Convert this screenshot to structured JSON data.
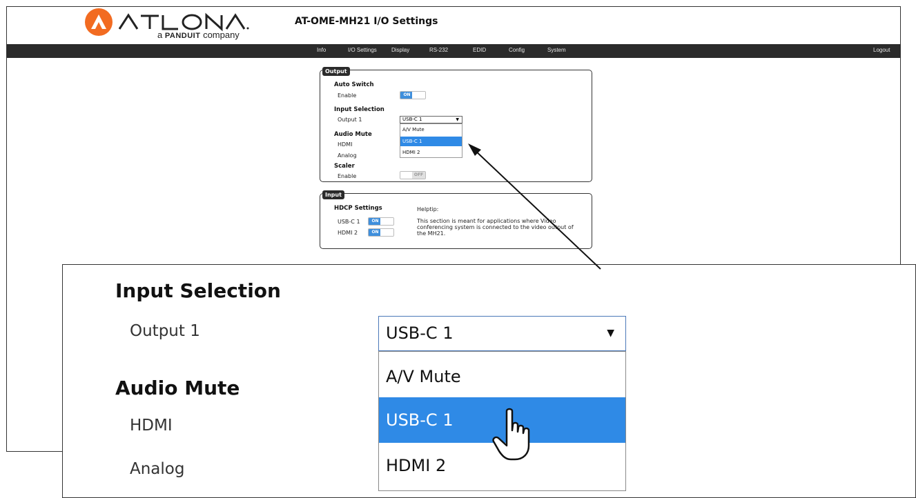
{
  "brand": {
    "logo_text": "ATLONA",
    "tagline_prefix": "a",
    "tagline_brand": "PANDUIT",
    "tagline_suffix": "company",
    "accent_color": "#f26b21"
  },
  "page_title": "AT-OME-MH21  I/O Settings",
  "nav": {
    "items": [
      "Info",
      "I/O Settings",
      "Display",
      "RS-232",
      "EDID",
      "Config",
      "System"
    ],
    "logout": "Logout"
  },
  "output_panel": {
    "legend": "Output",
    "auto_switch": {
      "heading": "Auto Switch",
      "label": "Enable",
      "state": "ON"
    },
    "input_selection": {
      "heading": "Input Selection",
      "label": "Output 1",
      "selected": "USB-C 1",
      "options": [
        "A/V Mute",
        "USB-C 1",
        "HDMI 2"
      ],
      "highlighted_index": 1
    },
    "audio_mute": {
      "heading": "Audio Mute",
      "hdmi_label": "HDMI",
      "analog_label": "Analog"
    },
    "scaler": {
      "heading": "Scaler",
      "label": "Enable",
      "state": "OFF"
    }
  },
  "input_panel": {
    "legend": "Input",
    "hdcp": {
      "heading": "HDCP Settings",
      "rows": [
        {
          "label": "USB-C 1",
          "state": "ON"
        },
        {
          "label": "HDMI 2",
          "state": "ON"
        }
      ]
    },
    "helptip": {
      "title": "Helptip:",
      "line1": "This section is meant for applications where Video",
      "line2": "conferencing system is connected to the video output of",
      "line3": "the MH21."
    }
  },
  "zoom": {
    "input_selection": "Input Selection",
    "output_label": "Output 1",
    "selected": "USB-C 1",
    "options": [
      "A/V Mute",
      "USB-C 1",
      "HDMI 2"
    ],
    "audio_mute": "Audio Mute",
    "hdmi": "HDMI",
    "analog": "Analog"
  },
  "colors": {
    "navbar": "#2b2b2b",
    "toggle_on": "#3f8fdc",
    "selection": "#2f8ae6"
  }
}
